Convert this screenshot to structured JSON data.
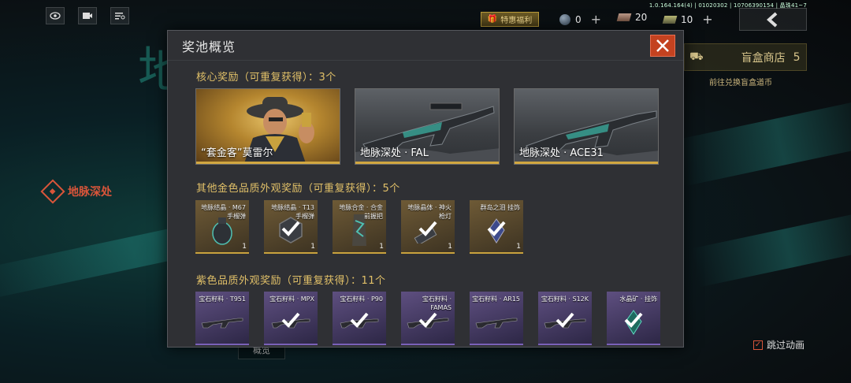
{
  "topbar": {
    "version": "1.0.164.164(4) | 01020302 | 10706390154 | 晶珠41~7",
    "welfare_label": "特惠福利",
    "currencies": [
      {
        "icon": "gem-icon",
        "value": "0"
      },
      {
        "icon": "ticket-icon",
        "value": "20"
      },
      {
        "icon": "voucher-icon",
        "value": "10"
      }
    ]
  },
  "background": {
    "side_label": "地脉深处",
    "shop_label": "盲盒商店",
    "shop_count": "5",
    "shop_sub": "前往兑换盲盒道币",
    "skip_anim_label": "跳过动画",
    "bottom_tab": "概览"
  },
  "modal": {
    "title": "奖池概览",
    "core_section": "核心奖励（可重复获得）：3个",
    "core_items": [
      {
        "label": "“套金客”莫雷尔"
      },
      {
        "label": "地脉深处 · FAL"
      },
      {
        "label": "地脉深处 · ACE31"
      }
    ],
    "gold_section": "其他金色品质外观奖励（可重复获得）：5个",
    "gold_items": [
      {
        "name": "地脉结晶 · M67手榴弹",
        "count": "1",
        "checked": false
      },
      {
        "name": "地脉结晶 · T13手榴弹",
        "count": "1",
        "checked": true
      },
      {
        "name": "地脉合金 · 合金前握把",
        "count": "1",
        "checked": false
      },
      {
        "name": "地脉晶体 · 神火枪灯",
        "count": "1",
        "checked": true
      },
      {
        "name": "群岛之泪 挂饰",
        "count": "1",
        "checked": true
      }
    ],
    "purple_section": "紫色品质外观奖励（可重复获得）：11个",
    "purple_items": [
      {
        "name": "宝石籽料 · T951",
        "checked": false
      },
      {
        "name": "宝石籽料 · MPX",
        "checked": true
      },
      {
        "name": "宝石籽料 · P90",
        "checked": true
      },
      {
        "name": "宝石籽料 · FAMAS",
        "checked": true
      },
      {
        "name": "宝石籽料 · AR15",
        "checked": false
      },
      {
        "name": "宝石籽料 · S12K",
        "checked": true
      },
      {
        "name": "水晶矿 · 挂饰",
        "checked": true
      }
    ]
  }
}
